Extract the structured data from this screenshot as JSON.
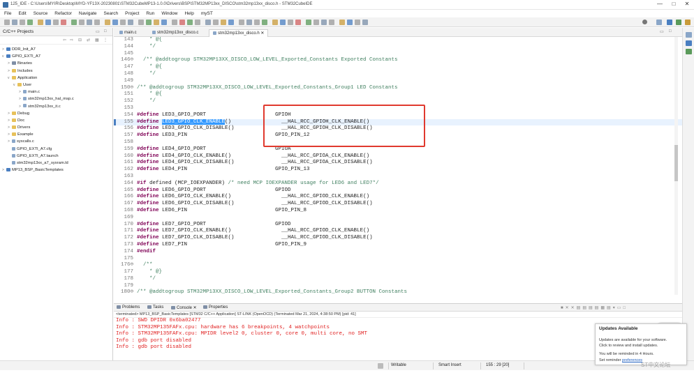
{
  "window": {
    "title": "125_IDE - C:\\Users\\MYIR\\Desktop\\MYD-YF13X-20230801\\STM32CubeMP13-1.0.0\\Drivers\\BSP\\STM32MP13xx_DISCO\\stm32mp13xx_disco.h - STM32CubeIDE",
    "minimize": "—",
    "maximize": "□",
    "close": "✕"
  },
  "menu": [
    "File",
    "Edit",
    "Source",
    "Refactor",
    "Navigate",
    "Search",
    "Project",
    "Run",
    "Window",
    "Help",
    "myST"
  ],
  "project_explorer": {
    "title": "C/C++ Projects",
    "tree": [
      {
        "label": "DDR_Init_A7",
        "icon": "project-icon",
        "depth": 0,
        "arrow": ">"
      },
      {
        "label": "GPIO_EXTI_A7",
        "icon": "project-icon",
        "depth": 0,
        "arrow": "v"
      },
      {
        "label": "Binaries",
        "icon": "binaries-icon",
        "depth": 1,
        "arrow": ">"
      },
      {
        "label": "Includes",
        "icon": "folder-icon",
        "depth": 1,
        "arrow": ">"
      },
      {
        "label": "Application",
        "icon": "folder-icon",
        "depth": 1,
        "arrow": "v"
      },
      {
        "label": "User",
        "icon": "folder-icon",
        "depth": 2,
        "arrow": "v"
      },
      {
        "label": "main.c",
        "icon": "file-icon",
        "depth": 3,
        "arrow": ">"
      },
      {
        "label": "stm32mp13xx_hal_msp.c",
        "icon": "file-icon",
        "depth": 3,
        "arrow": ">"
      },
      {
        "label": "stm32mp13xx_it.c",
        "icon": "file-icon",
        "depth": 3,
        "arrow": ">"
      },
      {
        "label": "Debug",
        "icon": "folder-icon",
        "depth": 1,
        "arrow": ">"
      },
      {
        "label": "Doc",
        "icon": "folder-icon",
        "depth": 1,
        "arrow": ">"
      },
      {
        "label": "Drivers",
        "icon": "folder-icon",
        "depth": 1,
        "arrow": ">"
      },
      {
        "label": "Example",
        "icon": "folder-icon",
        "depth": 1,
        "arrow": ">"
      },
      {
        "label": "syscalls.c",
        "icon": "file-icon",
        "depth": 1,
        "arrow": ">"
      },
      {
        "label": "GPIO_EXTI_A7.cfg",
        "icon": "file-icon",
        "depth": 1,
        "arrow": ""
      },
      {
        "label": "GPIO_EXTI_A7.launch",
        "icon": "file-icon",
        "depth": 1,
        "arrow": ""
      },
      {
        "label": "stm32mp13xx_a7_sysram.ld",
        "icon": "file-icon",
        "depth": 1,
        "arrow": ""
      },
      {
        "label": "MP13_BSP_BasicTemplates",
        "icon": "project-icon",
        "depth": 0,
        "arrow": ">"
      }
    ]
  },
  "editor": {
    "tabs": [
      {
        "label": "main.c",
        "active": false
      },
      {
        "label": "stm32mp13xx_disco.c",
        "active": false
      },
      {
        "label": "stm32mp13xx_disco.h",
        "active": true,
        "close": "✕"
      }
    ],
    "lines": [
      {
        "n": "143",
        "parts": [
          {
            "t": "    * @{",
            "c": "cm"
          }
        ]
      },
      {
        "n": "144",
        "parts": [
          {
            "t": "    */",
            "c": "cm"
          }
        ]
      },
      {
        "n": "145",
        "parts": [
          {
            "t": "",
            "c": ""
          }
        ]
      },
      {
        "n": "146⊖",
        "parts": [
          {
            "t": "  /** @addtogroup STM32MP13XX_DISCO_LOW_LEVEL_Exported_Constants Exported Constants",
            "c": "cm"
          }
        ]
      },
      {
        "n": "147",
        "parts": [
          {
            "t": "    * @{",
            "c": "cm"
          }
        ]
      },
      {
        "n": "148",
        "parts": [
          {
            "t": "    */",
            "c": "cm"
          }
        ]
      },
      {
        "n": "149",
        "parts": [
          {
            "t": "",
            "c": ""
          }
        ]
      },
      {
        "n": "150⊖",
        "parts": [
          {
            "t": "/** @addtogroup STM32MP13XX_DISCO_LOW_LEVEL_Exported_Constants_Group1 LED Constants",
            "c": "cm"
          }
        ]
      },
      {
        "n": "151",
        "parts": [
          {
            "t": "    * @{",
            "c": "cm"
          }
        ]
      },
      {
        "n": "152",
        "parts": [
          {
            "t": "    */",
            "c": "cm"
          }
        ]
      },
      {
        "n": "153",
        "parts": [
          {
            "t": "",
            "c": ""
          }
        ]
      },
      {
        "n": "154",
        "parts": [
          {
            "t": "#define",
            "c": "kw"
          },
          {
            "t": " LED3_GPIO_PORT                      GPIOH",
            "c": ""
          }
        ]
      },
      {
        "n": "155",
        "hl": true,
        "parts": [
          {
            "t": "#define",
            "c": "kw"
          },
          {
            "t": " ",
            "c": ""
          },
          {
            "t": "LED3_GPIO_CLK_ENABLE",
            "c": "sel"
          },
          {
            "t": "()                __HAL_RCC_GPIOH_CLK_ENABLE()",
            "c": ""
          }
        ]
      },
      {
        "n": "156",
        "parts": [
          {
            "t": "#define",
            "c": "kw"
          },
          {
            "t": " LED3_GPIO_CLK_DISABLE()               __HAL_RCC_GPIOH_CLK_DISABLE()",
            "c": ""
          }
        ]
      },
      {
        "n": "157",
        "parts": [
          {
            "t": "#define",
            "c": "kw"
          },
          {
            "t": " LED3_PIN                            GPIO_PIN_12",
            "c": ""
          }
        ]
      },
      {
        "n": "158",
        "parts": [
          {
            "t": "",
            "c": ""
          }
        ]
      },
      {
        "n": "159",
        "parts": [
          {
            "t": "#define",
            "c": "kw"
          },
          {
            "t": " LED4_GPIO_PORT                      GPIOA",
            "c": ""
          }
        ]
      },
      {
        "n": "160",
        "parts": [
          {
            "t": "#define",
            "c": "kw"
          },
          {
            "t": " LED4_GPIO_CLK_ENABLE()                __HAL_RCC_GPIOA_CLK_ENABLE()",
            "c": ""
          }
        ]
      },
      {
        "n": "161",
        "parts": [
          {
            "t": "#define",
            "c": "kw"
          },
          {
            "t": " LED4_GPIO_CLK_DISABLE()               __HAL_RCC_GPIOA_CLK_DISABLE()",
            "c": ""
          }
        ]
      },
      {
        "n": "162",
        "parts": [
          {
            "t": "#define",
            "c": "kw"
          },
          {
            "t": " LED4_PIN                            GPIO_PIN_13",
            "c": ""
          }
        ]
      },
      {
        "n": "163",
        "parts": [
          {
            "t": "",
            "c": ""
          }
        ]
      },
      {
        "n": "164",
        "parts": [
          {
            "t": "#if",
            "c": "kw"
          },
          {
            "t": " defined (MCP_IOEXPANDER) ",
            "c": ""
          },
          {
            "t": "/* need MCP IOEXPANDER usage for LED6 and LED7*/",
            "c": "cm"
          }
        ]
      },
      {
        "n": "165",
        "parts": [
          {
            "t": "#define",
            "c": "kw"
          },
          {
            "t": " LED6_GPIO_PORT                      GPIOD",
            "c": ""
          }
        ]
      },
      {
        "n": "166",
        "parts": [
          {
            "t": "#define",
            "c": "kw"
          },
          {
            "t": " LED6_GPIO_CLK_ENABLE()                __HAL_RCC_GPIOD_CLK_ENABLE()",
            "c": ""
          }
        ]
      },
      {
        "n": "167",
        "parts": [
          {
            "t": "#define",
            "c": "kw"
          },
          {
            "t": " LED6_GPIO_CLK_DISABLE()               __HAL_RCC_GPIOD_CLK_DISABLE()",
            "c": ""
          }
        ]
      },
      {
        "n": "168",
        "parts": [
          {
            "t": "#define",
            "c": "kw"
          },
          {
            "t": " LED6_PIN                            GPIO_PIN_8",
            "c": ""
          }
        ]
      },
      {
        "n": "169",
        "parts": [
          {
            "t": "",
            "c": ""
          }
        ]
      },
      {
        "n": "170",
        "parts": [
          {
            "t": "#define",
            "c": "kw"
          },
          {
            "t": " LED7_GPIO_PORT                      GPIOD",
            "c": ""
          }
        ]
      },
      {
        "n": "171",
        "parts": [
          {
            "t": "#define",
            "c": "kw"
          },
          {
            "t": " LED7_GPIO_CLK_ENABLE()                __HAL_RCC_GPIOD_CLK_ENABLE()",
            "c": ""
          }
        ]
      },
      {
        "n": "172",
        "parts": [
          {
            "t": "#define",
            "c": "kw"
          },
          {
            "t": " LED7_GPIO_CLK_DISABLE()               __HAL_RCC_GPIOD_CLK_DISABLE()",
            "c": ""
          }
        ]
      },
      {
        "n": "173",
        "parts": [
          {
            "t": "#define",
            "c": "kw"
          },
          {
            "t": " LED7_PIN                            GPIO_PIN_9",
            "c": ""
          }
        ]
      },
      {
        "n": "174",
        "parts": [
          {
            "t": "#endif",
            "c": "kw"
          }
        ]
      },
      {
        "n": "175",
        "parts": [
          {
            "t": "",
            "c": ""
          }
        ]
      },
      {
        "n": "176⊖",
        "parts": [
          {
            "t": "  /**",
            "c": "cm"
          }
        ]
      },
      {
        "n": "177",
        "parts": [
          {
            "t": "    * @}",
            "c": "cm"
          }
        ]
      },
      {
        "n": "178",
        "parts": [
          {
            "t": "    */",
            "c": "cm"
          }
        ]
      },
      {
        "n": "179",
        "parts": [
          {
            "t": "",
            "c": ""
          }
        ]
      },
      {
        "n": "180⊖",
        "parts": [
          {
            "t": "/** @addtogroup STM32MP13XX_DISCO_LOW_LEVEL_Exported_Constants_Group2 BUTTON Constants",
            "c": "cm"
          }
        ]
      }
    ]
  },
  "console": {
    "tabs": [
      {
        "label": "Problems",
        "name": "tab-problems"
      },
      {
        "label": "Tasks",
        "name": "tab-tasks"
      },
      {
        "label": "Console",
        "name": "tab-console",
        "close": "✕"
      },
      {
        "label": "Properties",
        "name": "tab-properties"
      }
    ],
    "info": "<terminated> MP13_BSP_BasicTemplates [STM32 C/C++ Application] ST-LINK (OpenOCD) (Terminated Mar 21, 2024, 4:38:50 PM) [pid: 41]",
    "output": [
      "Info : SWD DPIDR 0x6ba02477",
      "Info : STM32MP135FAFx.cpu: hardware has 6 breakpoints, 4 watchpoints",
      "Info : STM32MP135FAFx.cpu: MPIDR level2 0, cluster 0, core 0, multi core, no SMT",
      "Info : gdb port disabled",
      "Info : gdb port disabled"
    ]
  },
  "status": {
    "writable": "Writable",
    "insert_mode": "Smart Insert",
    "position": "155 : 29 [20]"
  },
  "notification": {
    "title": "Updates Available",
    "line1": "Updates are available for your software.",
    "line2": "Click to review and install updates.",
    "line3": "You will be reminded in 4 Hours.",
    "line4_prefix": "Set reminder ",
    "line4_link": "preferences"
  },
  "watermark": "ST中文论坛",
  "colors": {
    "keyword": "#7f0055",
    "comment": "#3f7f5f",
    "selection": "#3399ff",
    "console_error": "#e02020",
    "annotation_box": "#e0392e"
  }
}
